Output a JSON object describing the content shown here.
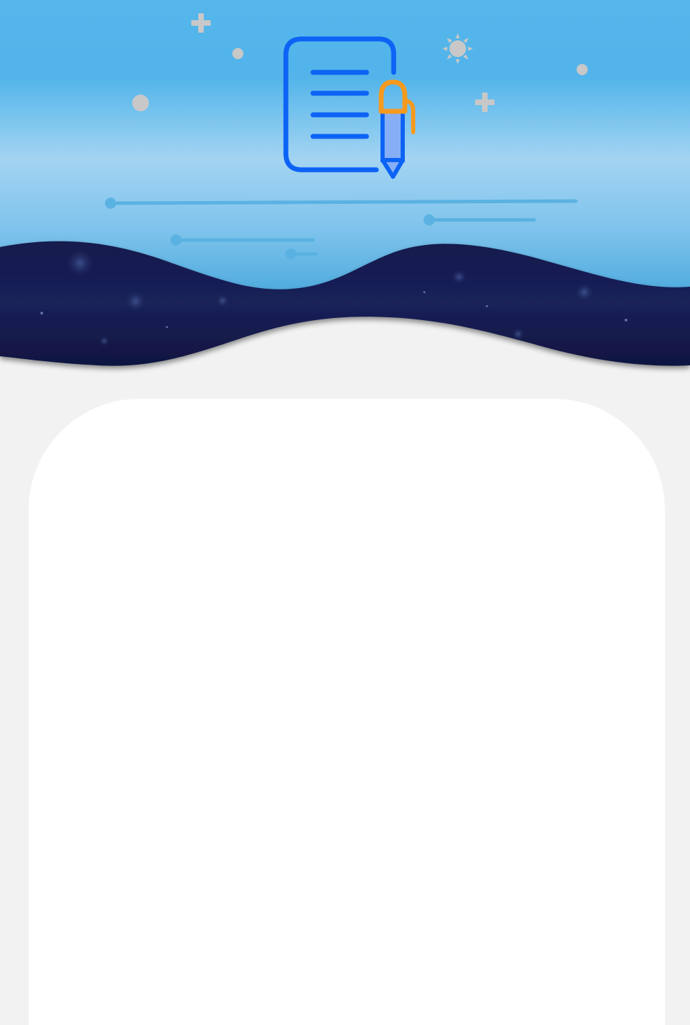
{
  "theme": {
    "page_background": "#f2f2f2",
    "sky_top": "#54b6eb",
    "sky_mid": "#a3d4f2",
    "sky_bottom": "#45a6dc",
    "night_band": "#141a4a",
    "card_background": "#ffffff",
    "doc_icon_color": "#0c63f5",
    "pen_clip_color": "#f59a1f",
    "pen_body_color": "#86aef7",
    "decor_color": "#c8c8c8",
    "line_color": "#5ab2e2"
  },
  "icons": {
    "hero": "document-with-pen-icon",
    "decor": [
      "plus-icon",
      "sun-icon",
      "dot-icon"
    ]
  }
}
